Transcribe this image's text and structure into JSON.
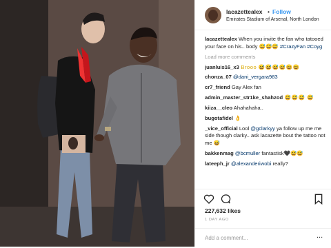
{
  "header": {
    "username": "lacazettealex",
    "separator": "•",
    "follow_label": "Follow",
    "location": "Emirates Stadium of Arsenal, North London"
  },
  "caption": {
    "username": "lacazettealex",
    "text": " When you invite the fan who tatooed your face on his.. body 😅😅😅 ",
    "hashtags": "#CrazyFan #Coyg"
  },
  "load_more_label": "Load more comments",
  "comments": [
    {
      "user": "juanluis16_x3",
      "text": " Brooo 😅😅😅😅😄😄"
    },
    {
      "user": "chonza_07",
      "mention": " @dani_vergara983",
      "text": ""
    },
    {
      "user": "cr7_friend",
      "text": " Gay Alex fan"
    },
    {
      "user": "admin_master_str1ke_shahzod",
      "text": " 😅😅😅 😅"
    },
    {
      "user": "kiiza__cleo",
      "text": " Ahahahaha.."
    },
    {
      "user": "bugotafidel",
      "text": " 👌"
    },
    {
      "user": "_vice_official",
      "text": " Lool ",
      "mention": "@gclarkyy",
      "text2": " ya follow up me me side though clarky.. ask lacazette bout the tattoo not me 😅"
    },
    {
      "user": "bakkenmag",
      "mention": " @bcmuller",
      "text": " fantastisk🖤😅😅"
    },
    {
      "user": "lateeph_jr",
      "mention": " @alexanderiwobi",
      "text": " really?"
    }
  ],
  "likes_text": "227,632 likes",
  "time_ago": "1 DAY AGO",
  "add_comment_placeholder": "Add a comment...",
  "more_label": "...",
  "icons": {
    "like": "heart-icon",
    "comment": "comment-icon",
    "save": "bookmark-icon"
  }
}
